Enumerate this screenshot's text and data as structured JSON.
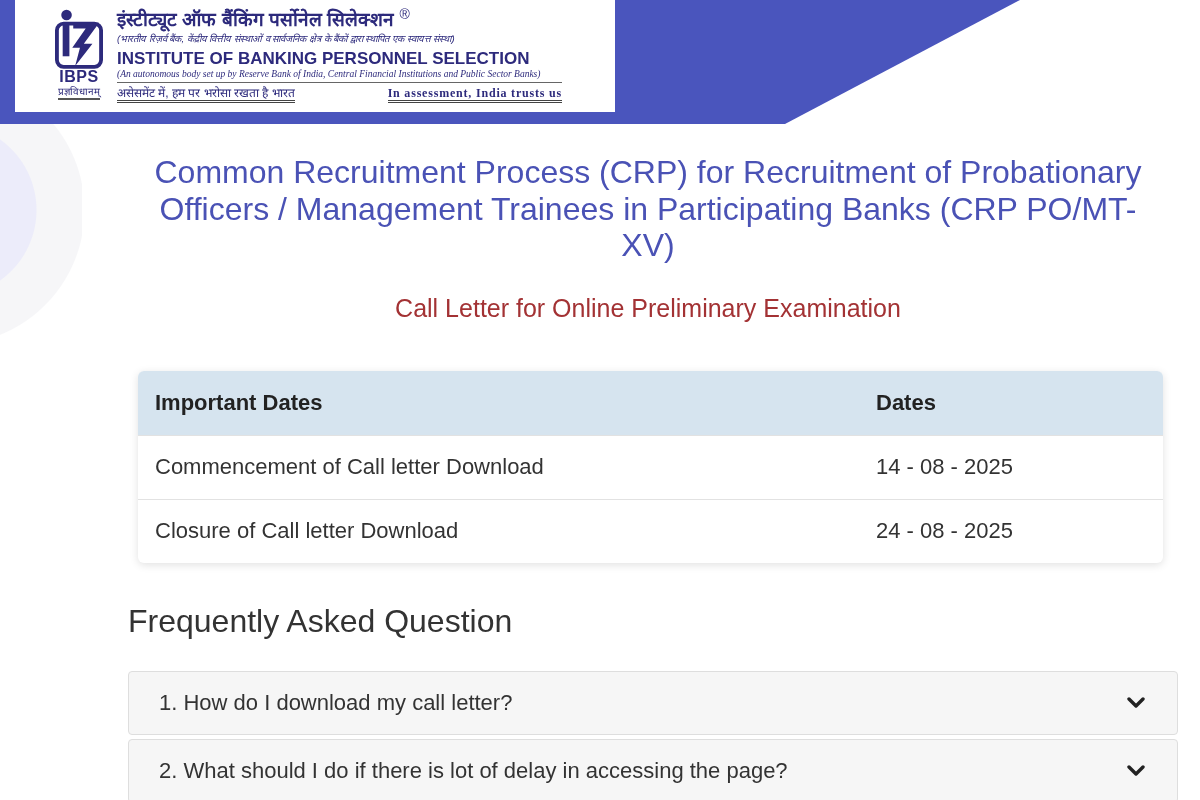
{
  "header": {
    "logo": {
      "abbreviation": "IBPS",
      "motto": "प्रज्ञविधानम्",
      "name_hindi": "इंस्टीट्यूट ऑफ बैंकिंग पर्सोनेल सिलेक्शन $^{®}$",
      "description_hindi": "(भारतीय रिज़र्व बैंक, केंद्रीय वित्तीय संस्थाओं व सार्वजनिक क्षेत्र के बैंकों द्वारा स्थापित एक स्वायत्त संस्था)",
      "name_english": "INSTITUTE OF BANKING PERSONNEL SELECTION",
      "description_english": "(An autonomous body set up by Reserve Bank of India, Central Financial Institutions and Public Sector Banks)",
      "tagline_hindi": "असेसमेंट में, हम पर भरोसा रखता है भारत",
      "tagline_english": "In assessment, India trusts us"
    }
  },
  "title": "Common Recruitment Process (CRP) for Recruitment of Probationary Officers / Management Trainees in Participating Banks (CRP PO/MT-XV)",
  "subtitle": "Call Letter for Online Preliminary Examination",
  "dates_table": {
    "columns": [
      "Important Dates",
      "Dates"
    ],
    "rows": [
      [
        "Commencement of Call letter Download",
        "14 - 08 - 2025"
      ],
      [
        "Closure of Call letter Download",
        "24 - 08 - 2025"
      ]
    ]
  },
  "faq": {
    "heading": "Frequently Asked Question",
    "items": [
      {
        "question": "1. How do I download my call letter?",
        "expanded": false
      },
      {
        "question": "2. What should I do if there is lot of delay in accessing the page?",
        "expanded": false
      }
    ]
  }
}
